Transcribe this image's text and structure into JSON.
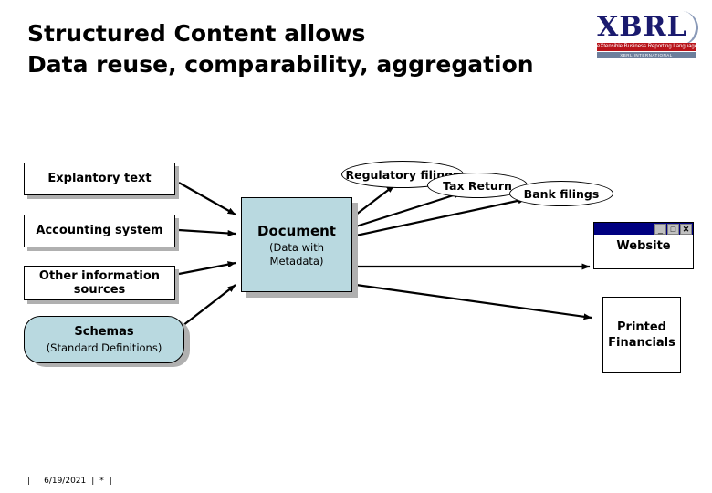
{
  "title": {
    "line1": "Structured Content allows",
    "line2": "Data reuse, comparability, aggregation"
  },
  "logo": {
    "wordmark": "XBRL",
    "tagline": "eXtensible Business Reporting Language",
    "subbar": "XBRL INTERNATIONAL"
  },
  "inputs": [
    {
      "label": "Explantory text"
    },
    {
      "label": "Accounting system"
    },
    {
      "label": "Other information sources"
    }
  ],
  "schemas": {
    "title": "Schemas",
    "subtitle": "(Standard Definitions)"
  },
  "document": {
    "title": "Document",
    "sub1": "(Data with",
    "sub2": "Metadata)"
  },
  "outputs": {
    "regulatory": "Regulatory filings",
    "tax": "Tax Return",
    "bank": "Bank filings",
    "website": "Website",
    "printed_line1": "Printed",
    "printed_line2": "Financials"
  },
  "window_buttons": {
    "minimize": "_",
    "maximize": "□",
    "close": "✕"
  },
  "footer": {
    "pre": "|",
    "sep1": "|",
    "date": "6/19/2021",
    "sep2": "|",
    "page": "*",
    "sep3": "|"
  },
  "colors": {
    "accent_fill": "#b9d9e0",
    "title_navy": "#000080",
    "logo_navy": "#1a1a6e",
    "logo_red": "#b9141a"
  }
}
